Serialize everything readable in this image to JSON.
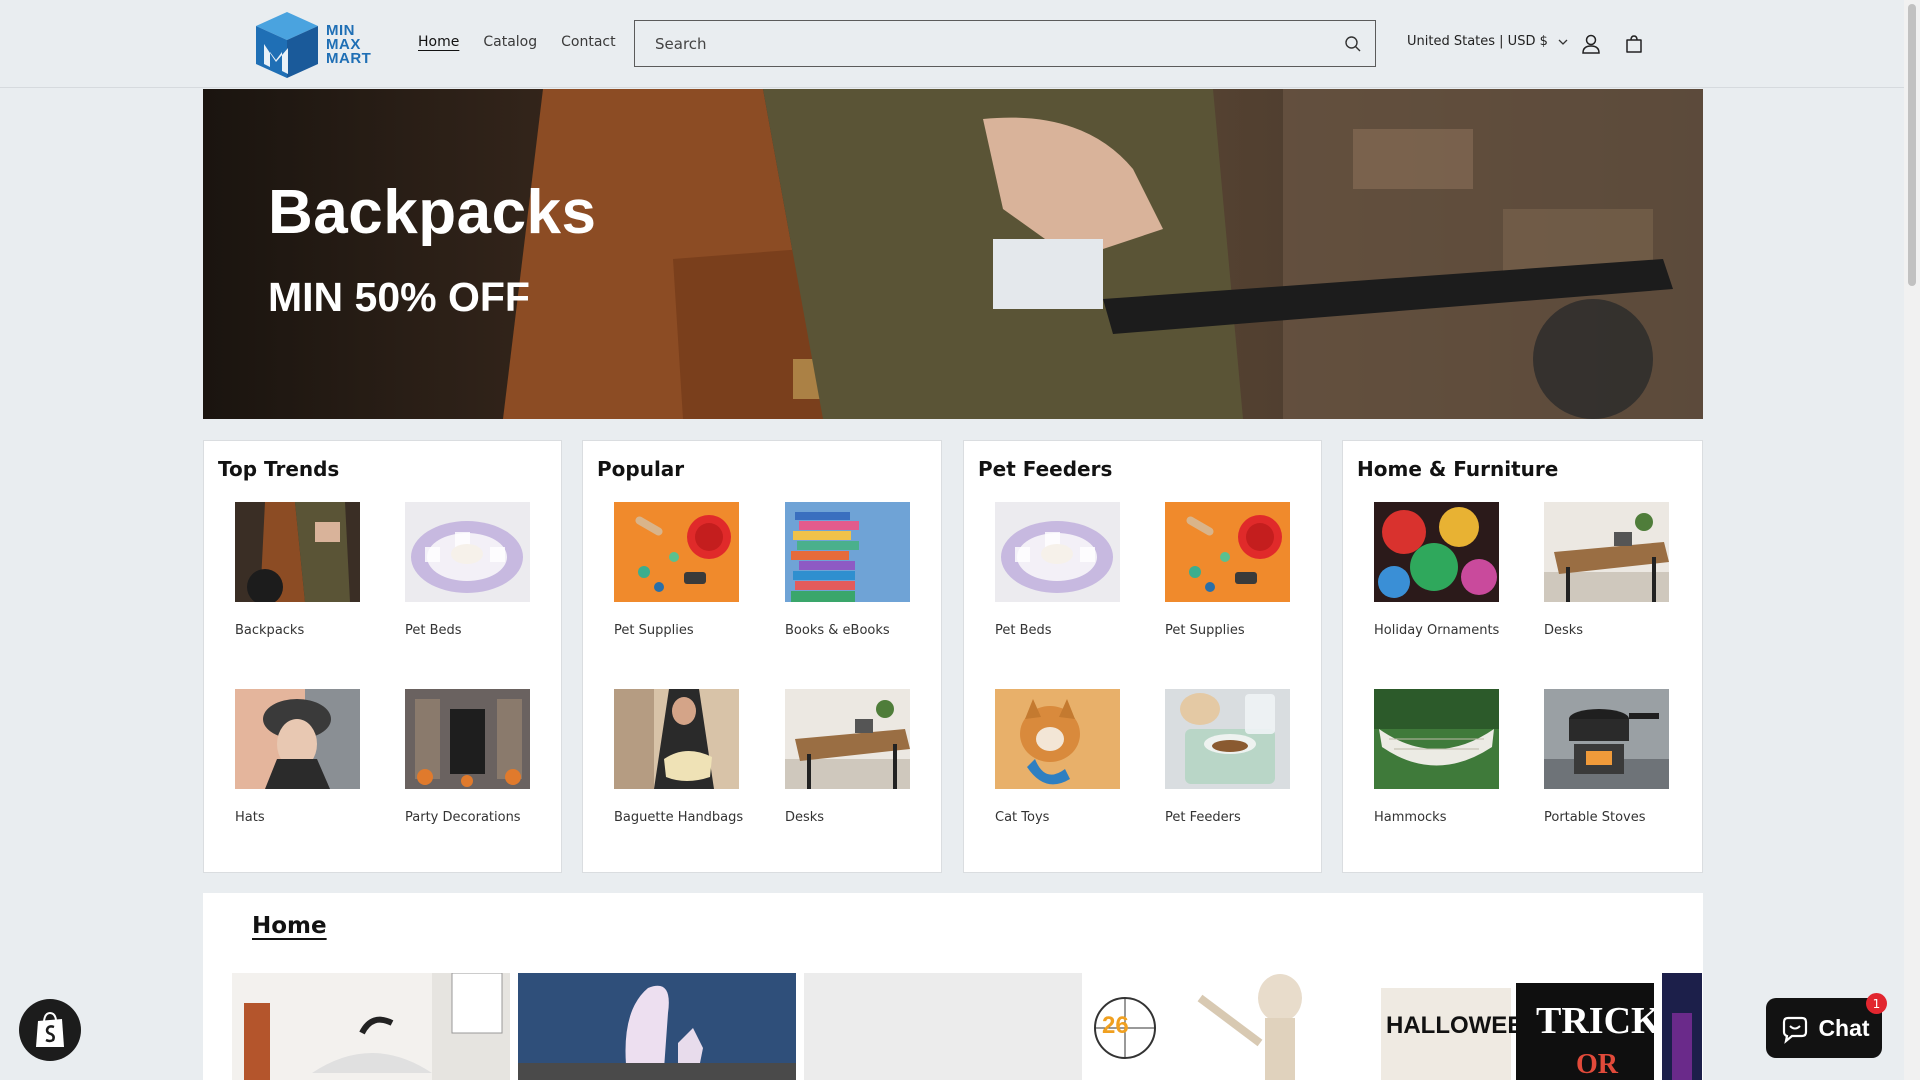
{
  "header": {
    "logo_lines": [
      "MIN",
      "MAX",
      "MART"
    ],
    "nav": [
      {
        "label": "Home",
        "active": true
      },
      {
        "label": "Catalog",
        "active": false
      },
      {
        "label": "Contact",
        "active": false
      }
    ],
    "search_placeholder": "Search",
    "country": "United States | USD $",
    "colors": {
      "brand": "#1f6fb5",
      "background": "#e9edf0"
    }
  },
  "hero": {
    "title": "Backpacks",
    "subtitle": "MIN 50% OFF"
  },
  "cards": [
    {
      "title": "Top Trends",
      "items": [
        "Backpacks",
        "Pet Beds",
        "Hats",
        "Party Decorations"
      ]
    },
    {
      "title": "Popular",
      "items": [
        "Pet Supplies",
        "Books & eBooks",
        "Baguette Handbags",
        "Desks"
      ]
    },
    {
      "title": "Pet Feeders",
      "items": [
        "Pet Beds",
        "Pet Supplies",
        "Cat Toys",
        "Pet Feeders"
      ]
    },
    {
      "title": "Home & Furniture",
      "items": [
        "Holiday Ornaments",
        "Desks",
        "Hammocks",
        "Portable Stoves"
      ]
    }
  ],
  "home_section": {
    "title": "Home"
  },
  "chat": {
    "label": "Chat",
    "unread": "1"
  },
  "icons": {
    "search": "search-icon",
    "account": "account-icon",
    "cart": "cart-icon",
    "chevron": "chevron-down-icon",
    "shopify": "shopify-bag-icon",
    "chat": "chat-bubble-icon"
  }
}
